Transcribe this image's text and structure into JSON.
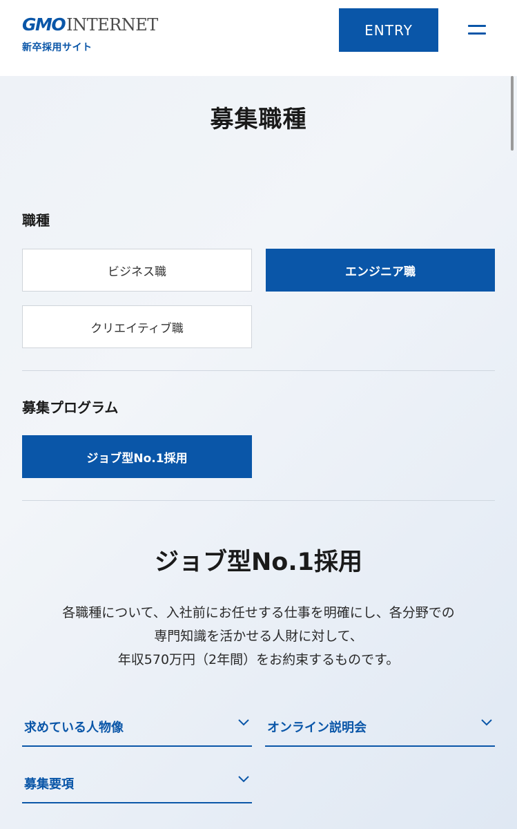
{
  "header": {
    "logo_brand": "GMO",
    "logo_rest": "INTERNET",
    "subtitle": "新卒採用サイト",
    "entry_label": "ENTRY"
  },
  "page": {
    "title": "募集職種"
  },
  "job_type": {
    "label": "職種",
    "options": [
      {
        "label": "ビジネス職",
        "selected": false
      },
      {
        "label": "エンジニア職",
        "selected": true
      },
      {
        "label": "クリエイティブ職",
        "selected": false
      }
    ]
  },
  "program": {
    "label": "募集プログラム",
    "options": [
      {
        "label": "ジョブ型No.1採用",
        "selected": true
      }
    ],
    "heading": "ジョブ型No.1採用",
    "description_lines": [
      "各職種について、入社前にお任せする仕事を明確にし、各分野での",
      "専門知識を活かせる人財に対して、",
      "年収570万円（2年間）をお約束するものです。"
    ]
  },
  "accordions": [
    {
      "label": "求めている人物像"
    },
    {
      "label": "オンライン説明会"
    },
    {
      "label": "募集要項"
    }
  ],
  "colors": {
    "brand": "#0a56a8"
  }
}
